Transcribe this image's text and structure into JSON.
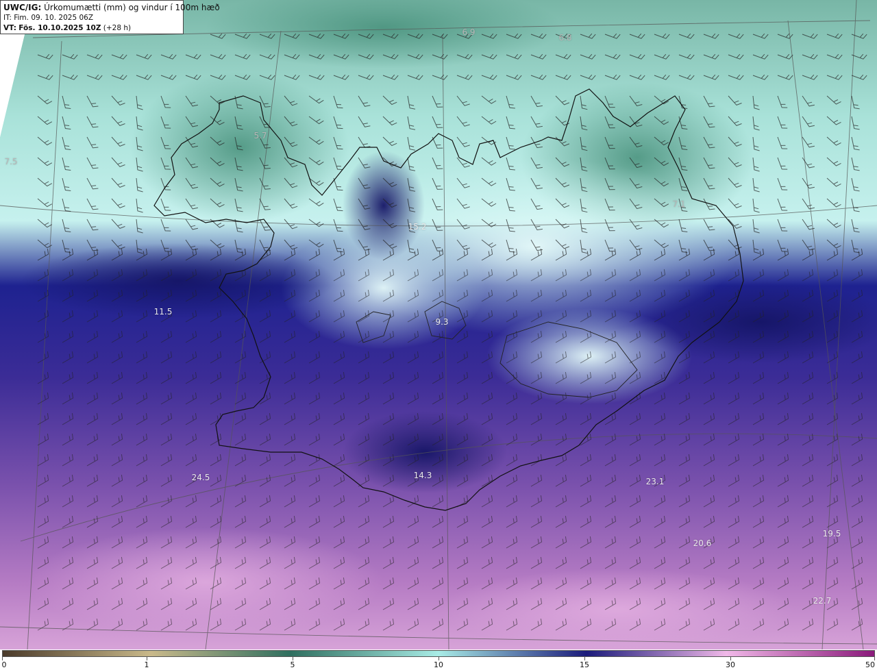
{
  "header": {
    "model": "UWC/IG:",
    "title": "Úrkomumætti (mm) og vindur í 100m hæð",
    "init_time": "IT: Fim. 09. 10. 2025 06Z",
    "valid_prefix": "VT:",
    "valid_time": "Fös. 10.10.2025 10Z",
    "lead": "(+28 h)"
  },
  "value_labels": [
    {
      "text": "6.9",
      "tone": "dark"
    },
    {
      "text": "6.8",
      "tone": "dark"
    },
    {
      "text": "7.5",
      "tone": "dark"
    },
    {
      "text": "5.7",
      "tone": "dark"
    },
    {
      "text": "15.2",
      "tone": "light"
    },
    {
      "text": "7.1",
      "tone": "dark"
    },
    {
      "text": "11.5",
      "tone": "light"
    },
    {
      "text": "9.3",
      "tone": "light"
    },
    {
      "text": "24.5",
      "tone": "light"
    },
    {
      "text": "14.3",
      "tone": "light"
    },
    {
      "text": "23.1",
      "tone": "light"
    },
    {
      "text": "20.6",
      "tone": "light"
    },
    {
      "text": "19.5",
      "tone": "light"
    },
    {
      "text": "22.7",
      "tone": "light"
    }
  ],
  "colorbar": {
    "ticks": [
      "0",
      "1",
      "5",
      "10",
      "15",
      "30",
      "50"
    ],
    "colors": [
      "#4a3a2a",
      "#c9b98a",
      "#2f6f5f",
      "#a8ece6",
      "#1b1b7a",
      "#f0b8e8",
      "#8a1a7a"
    ]
  },
  "map_colors": {
    "low": "#5fa492",
    "mid": "#bff2ee",
    "high": "#1f1f86",
    "heavy": "#7a4aa8",
    "extreme": "#c88fd0",
    "coast": "#111111",
    "grid": "#555555",
    "barb": "#222222"
  }
}
